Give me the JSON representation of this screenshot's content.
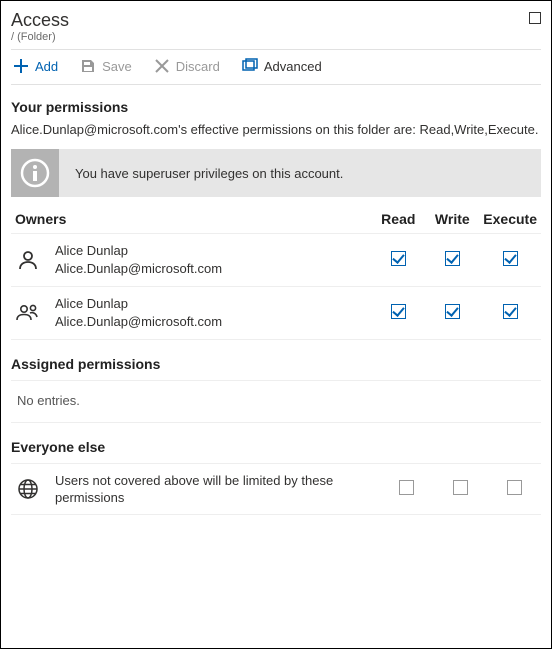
{
  "header": {
    "title": "Access",
    "subtitle": "/ (Folder)"
  },
  "toolbar": {
    "add": "Add",
    "save": "Save",
    "discard": "Discard",
    "advanced": "Advanced"
  },
  "yourPermissions": {
    "title": "Your permissions",
    "description": "Alice.Dunlap@microsoft.com's effective permissions on this folder are: Read,Write,Execute.",
    "banner": "You have superuser privileges on this account."
  },
  "columns": {
    "owners": "Owners",
    "read": "Read",
    "write": "Write",
    "execute": "Execute"
  },
  "owners": [
    {
      "name": "Alice Dunlap",
      "email": "Alice.Dunlap@microsoft.com",
      "type": "user",
      "read": true,
      "write": true,
      "execute": true
    },
    {
      "name": "Alice Dunlap",
      "email": "Alice.Dunlap@microsoft.com",
      "type": "group",
      "read": true,
      "write": true,
      "execute": true
    }
  ],
  "assigned": {
    "title": "Assigned permissions",
    "empty": "No entries."
  },
  "everyoneElse": {
    "title": "Everyone else",
    "text": "Users not covered above will be limited by these permissions",
    "read": false,
    "write": false,
    "execute": false
  }
}
